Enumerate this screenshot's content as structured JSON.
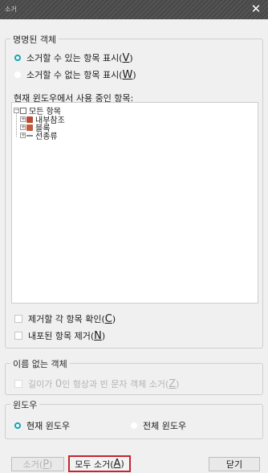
{
  "window": {
    "title": "소거",
    "close_glyph": "✕"
  },
  "named_objects": {
    "legend": "명명된 객체",
    "options": [
      {
        "label": "소거할 수 있는 항목 표시(",
        "mnemonic": "V",
        "suffix": ")",
        "selected": true
      },
      {
        "label": "소거할 수 없는 항목 표시(",
        "mnemonic": "W",
        "suffix": ")",
        "selected": false
      }
    ],
    "tree_label": "현재 윈도우에서 사용 중인 항목:",
    "tree": {
      "root": "모든 항목",
      "children": [
        "내부참조",
        "블록",
        "선종류"
      ]
    },
    "checks": [
      {
        "label": "제거할 각 항목 확인(",
        "mnemonic": "C",
        "suffix": ")",
        "checked": false
      },
      {
        "label": "내포된 항목 제거(",
        "mnemonic": "N",
        "suffix": ")",
        "checked": false
      }
    ]
  },
  "unnamed_objects": {
    "legend": "이름 없는 객체",
    "check_pre": "길이가 ",
    "check_zero": "0",
    "check_mid": "인 형상과 빈 문자 객체 소거(",
    "check_mnemonic": "Z",
    "check_suffix": ")"
  },
  "window_scope": {
    "legend": "윈도우",
    "options": [
      {
        "label": "현재 윈도우",
        "selected": true
      },
      {
        "label": "전체 윈도우",
        "selected": false
      }
    ]
  },
  "buttons": {
    "purge_label": "소거(",
    "purge_mnemonic": "P",
    "purge_suffix": ")",
    "purge_all_label": "모두 소거(",
    "purge_all_mnemonic": "A",
    "purge_all_suffix": ")",
    "close_label": "닫기"
  },
  "colors": {
    "accent_radio": "#13a3b0",
    "highlight_border": "#c1272d",
    "titlebar": "#474747"
  }
}
